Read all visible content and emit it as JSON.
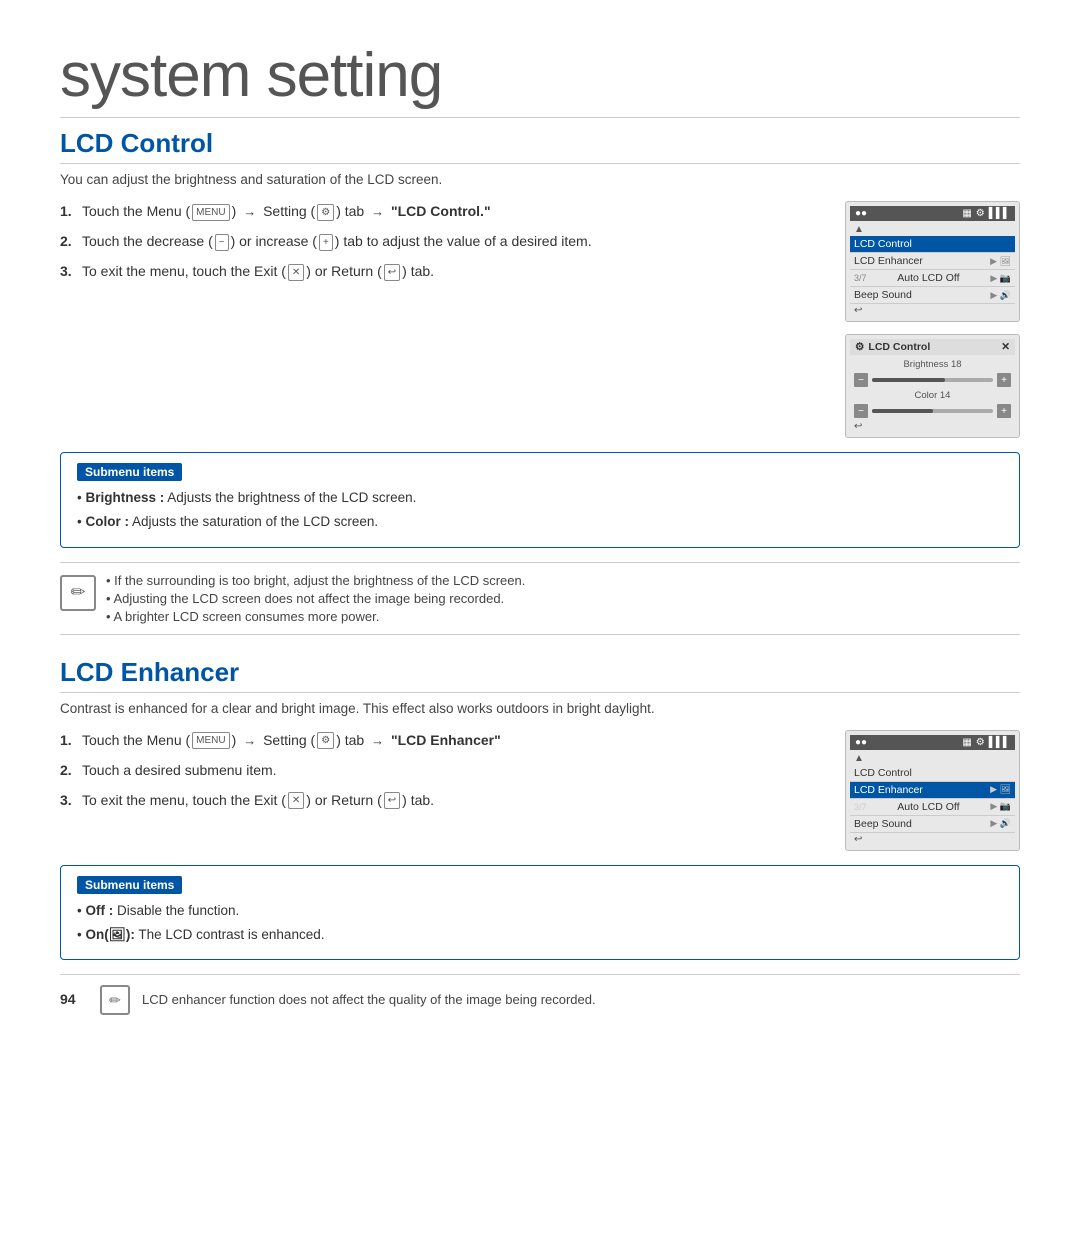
{
  "page": {
    "title": "system setting",
    "page_number": "94"
  },
  "lcd_control": {
    "heading": "LCD Control",
    "description": "You can adjust the brightness and saturation of the LCD screen.",
    "steps": [
      {
        "num": "1.",
        "text": "Touch the Menu (",
        "menu_icon": "MENU",
        "arrow": "→",
        "setting": "Setting",
        "setting_icon": "⚙",
        "tab_arrow": "tab →",
        "highlight": "\"LCD Control.\""
      },
      {
        "num": "2.",
        "text": "Touch the decrease (",
        "decrease_icon": "−",
        "text2": ") or increase (",
        "increase_icon": "+",
        "text3": ") tab to adjust the value of a desired item."
      },
      {
        "num": "3.",
        "text": "To exit the menu, touch the Exit (",
        "exit_icon": "✕",
        "text2": ") or Return (",
        "return_icon": "↩",
        "text3": ") tab."
      }
    ],
    "ui_panel1": {
      "title_icons": [
        "●●",
        "▦",
        "⚙",
        "▌▌▌"
      ],
      "rows": [
        {
          "label": "",
          "nav": "▲",
          "type": "nav"
        },
        {
          "label": "LCD Control",
          "selected": true,
          "arrow": ""
        },
        {
          "label": "LCD Enhancer",
          "arrow": "▶ 🖼"
        },
        {
          "page": "3/7",
          "label": "Auto LCD Off",
          "arrow": "▶ 📷"
        },
        {
          "label": "Beep Sound",
          "arrow": "▶ 🔊"
        },
        {
          "label": "",
          "nav": "↩",
          "type": "nav"
        }
      ]
    },
    "ui_panel2": {
      "title": "LCD Control",
      "title_close": "✕",
      "brightness_label": "Brightness 18",
      "brightness_value": 60,
      "color_label": "Color 14",
      "color_value": 50,
      "back_icon": "↩"
    },
    "submenu": {
      "label": "Submenu items",
      "items": [
        {
          "term": "Brightness :",
          "desc": "Adjusts the brightness of the LCD screen."
        },
        {
          "term": "Color :",
          "desc": "Adjusts the saturation of the LCD screen."
        }
      ]
    },
    "notes": [
      "If the surrounding is too bright, adjust the brightness of the LCD screen.",
      "Adjusting the LCD screen does not affect the image being recorded.",
      "A brighter LCD screen consumes more power."
    ]
  },
  "lcd_enhancer": {
    "heading": "LCD Enhancer",
    "description": "Contrast is enhanced for a clear and bright image. This effect also works outdoors in bright daylight.",
    "steps": [
      {
        "num": "1.",
        "text": "Touch the Menu (",
        "menu_icon": "MENU",
        "arrow": "→",
        "setting": "Setting",
        "setting_icon": "⚙",
        "tab_arrow": "tab →",
        "highlight": "\"LCD Enhancer\""
      },
      {
        "num": "2.",
        "text": "Touch a desired submenu item."
      },
      {
        "num": "3.",
        "text": "To exit the menu, touch the Exit (",
        "exit_icon": "✕",
        "text2": ") or Return (",
        "return_icon": "↩",
        "text3": ") tab."
      }
    ],
    "ui_panel1": {
      "title_icons": [
        "●●",
        "▦",
        "⚙",
        "▌▌▌"
      ],
      "rows": [
        {
          "label": "",
          "nav": "▲",
          "type": "nav"
        },
        {
          "label": "LCD Control",
          "arrow": ""
        },
        {
          "label": "LCD Enhancer",
          "selected": true,
          "arrow": "▶ 🖼"
        },
        {
          "page": "3/7",
          "label": "Auto LCD Off",
          "arrow": "▶ 📷"
        },
        {
          "label": "Beep Sound",
          "arrow": "▶ 🔊"
        },
        {
          "label": "",
          "nav": "↩",
          "type": "nav"
        }
      ]
    },
    "submenu": {
      "label": "Submenu items",
      "items": [
        {
          "term": "Off :",
          "desc": "Disable the function."
        },
        {
          "term": "On(🖼):",
          "desc": "The LCD contrast is enhanced."
        }
      ]
    },
    "footer_note": "LCD enhancer function does not affect the quality of the image being recorded."
  }
}
